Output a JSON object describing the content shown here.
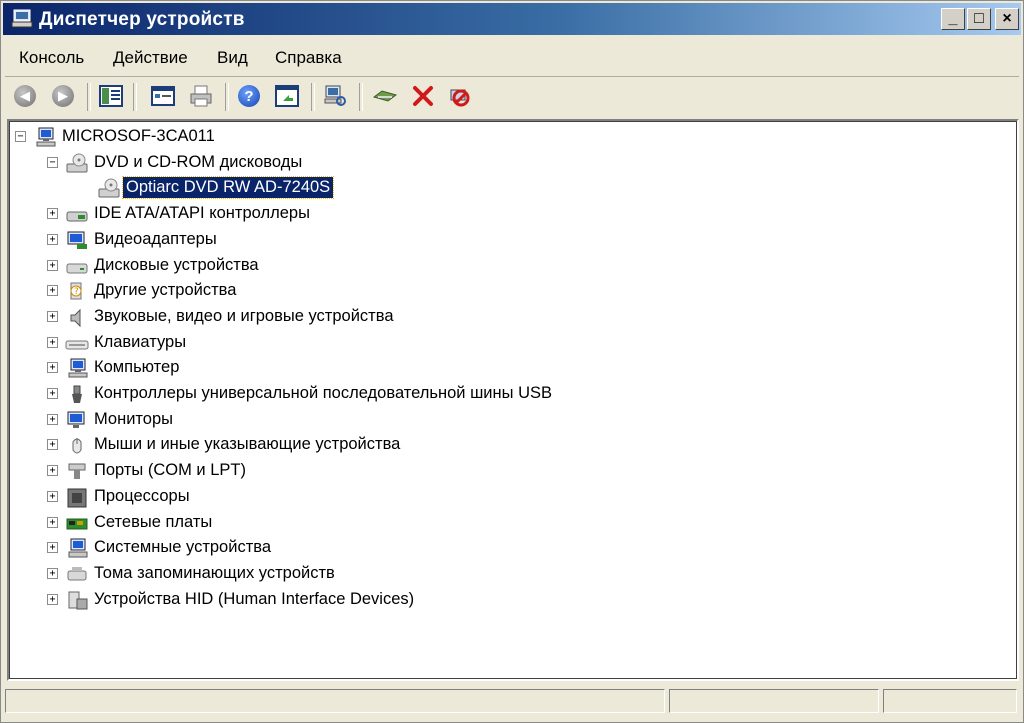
{
  "window": {
    "title": "Диспетчер устройств",
    "controls": {
      "minimize": "_",
      "maximize": "□",
      "close": "×"
    }
  },
  "menu": [
    "Консоль",
    "Действие",
    "Вид",
    "Справка"
  ],
  "toolbar": [
    {
      "icon": "back-icon"
    },
    {
      "icon": "forward-icon"
    },
    {
      "icon": "show-hide-tree-icon"
    },
    {
      "icon": "properties-icon"
    },
    {
      "icon": "print-icon"
    },
    {
      "icon": "help-icon"
    },
    {
      "icon": "view-icon"
    },
    {
      "icon": "scan-hardware-icon"
    },
    {
      "icon": "update-driver-icon"
    },
    {
      "icon": "uninstall-icon"
    },
    {
      "icon": "disable-icon"
    }
  ],
  "tree": {
    "root": {
      "label": "MICROSOF-3CA011",
      "icon": "computer-icon",
      "expanded": true
    },
    "dvd": {
      "label": "DVD и CD-ROM дисководы",
      "icon": "cdrom-icon",
      "expanded": true
    },
    "dvd_child": {
      "label": "Optiarc DVD RW AD-7240S",
      "icon": "cdrom-icon",
      "selected": true
    },
    "categories": [
      {
        "label": "IDE ATA/ATAPI контроллеры",
        "icon": "ide-controller-icon"
      },
      {
        "label": "Видеоадаптеры",
        "icon": "display-adapter-icon"
      },
      {
        "label": "Дисковые устройства",
        "icon": "disk-drive-icon"
      },
      {
        "label": "Другие устройства",
        "icon": "unknown-device-icon"
      },
      {
        "label": "Звуковые, видео и игровые устройства",
        "icon": "speaker-icon"
      },
      {
        "label": "Клавиатуры",
        "icon": "keyboard-icon"
      },
      {
        "label": "Компьютер",
        "icon": "computer-icon"
      },
      {
        "label": "Контроллеры универсальной последовательной шины USB",
        "icon": "usb-icon"
      },
      {
        "label": "Мониторы",
        "icon": "monitor-icon"
      },
      {
        "label": "Мыши и иные указывающие устройства",
        "icon": "mouse-icon"
      },
      {
        "label": "Порты (COM и LPT)",
        "icon": "port-icon"
      },
      {
        "label": "Процессоры",
        "icon": "processor-icon"
      },
      {
        "label": "Сетевые платы",
        "icon": "network-card-icon"
      },
      {
        "label": "Системные устройства",
        "icon": "system-device-icon"
      },
      {
        "label": "Тома запоминающих устройств",
        "icon": "storage-volume-icon"
      },
      {
        "label": "Устройства HID (Human Interface Devices)",
        "icon": "hid-icon"
      }
    ]
  },
  "colors": {
    "titlebar_start": "#0a246a",
    "titlebar_end": "#a6caf0",
    "selection": "#0a246a",
    "chrome": "#ece9d8"
  }
}
